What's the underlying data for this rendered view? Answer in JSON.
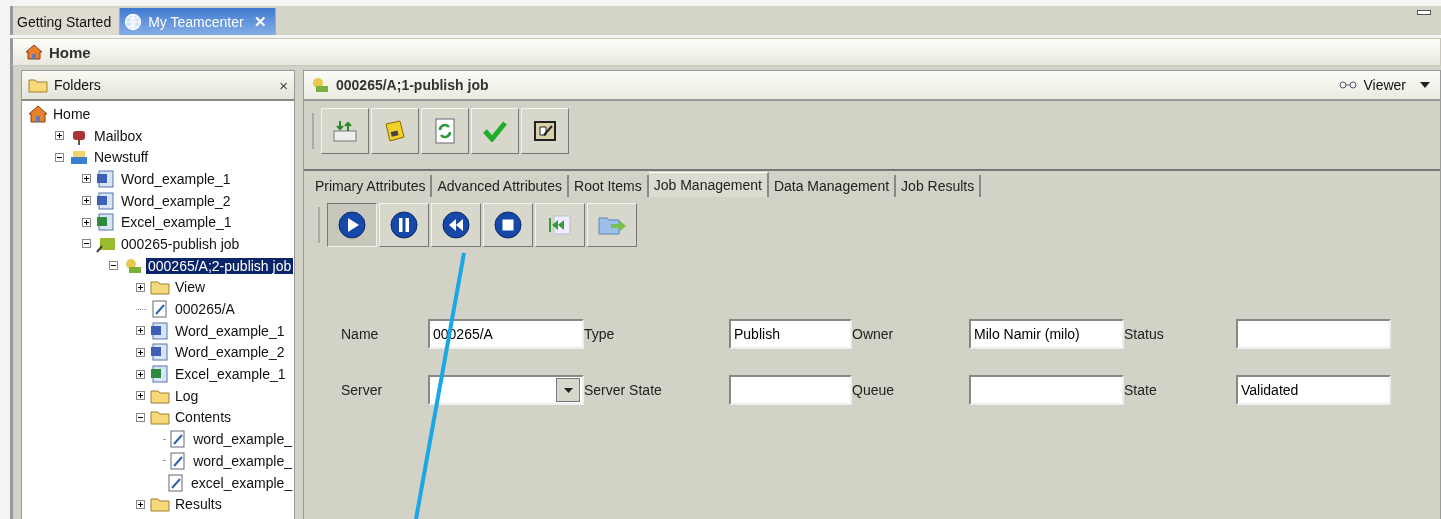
{
  "app_tabs": [
    {
      "label": "Getting Started",
      "selected": false
    },
    {
      "label": "My Teamcenter",
      "selected": true
    }
  ],
  "close_glyph": "✕",
  "breadcrumb": "Home",
  "folders_panel": {
    "title": "Folders",
    "close_glyph": "×",
    "tree": [
      {
        "label": "Home",
        "kind": "house",
        "selected": false,
        "children": [
          {
            "label": "Mailbox",
            "kind": "mailbox",
            "selected": false,
            "expanded": false
          },
          {
            "label": "Newstuff",
            "kind": "inbox",
            "selected": false,
            "expanded": true,
            "children": [
              {
                "label": "Word_example_1",
                "kind": "word",
                "selected": false,
                "expanded": false
              },
              {
                "label": "Word_example_2",
                "kind": "word",
                "selected": false,
                "expanded": false
              },
              {
                "label": "Excel_example_1",
                "kind": "excel",
                "selected": false,
                "expanded": false
              },
              {
                "label": "000265-publish job",
                "kind": "job",
                "selected": false,
                "expanded": true,
                "children": [
                  {
                    "label": "000265/A;2-publish job",
                    "kind": "revision",
                    "selected": true,
                    "expanded": true,
                    "children": [
                      {
                        "label": "View",
                        "kind": "folder",
                        "selected": false,
                        "expanded": false
                      },
                      {
                        "label": "000265/A",
                        "kind": "doc",
                        "selected": false
                      },
                      {
                        "label": "Word_example_1",
                        "kind": "word",
                        "selected": false,
                        "expanded": false
                      },
                      {
                        "label": "Word_example_2",
                        "kind": "word",
                        "selected": false,
                        "expanded": false
                      },
                      {
                        "label": "Excel_example_1",
                        "kind": "excel",
                        "selected": false,
                        "expanded": false
                      },
                      {
                        "label": "Log",
                        "kind": "folder",
                        "selected": false,
                        "expanded": false
                      },
                      {
                        "label": "Contents",
                        "kind": "folder",
                        "selected": false,
                        "expanded": true,
                        "children": [
                          {
                            "label": "word_example_",
                            "kind": "doc",
                            "selected": false
                          },
                          {
                            "label": "word_example_",
                            "kind": "doc",
                            "selected": false
                          },
                          {
                            "label": "excel_example_",
                            "kind": "doc",
                            "selected": false
                          }
                        ]
                      },
                      {
                        "label": "Results",
                        "kind": "folder",
                        "selected": false,
                        "expanded": false
                      }
                    ]
                  }
                ]
              }
            ]
          }
        ]
      }
    ]
  },
  "viewer": {
    "title": "000265/A;1-publish job",
    "mode": "Viewer"
  },
  "tabs": [
    {
      "label": "Primary Attributes",
      "selected": false
    },
    {
      "label": "Advanced Attributes",
      "selected": false
    },
    {
      "label": "Root Items",
      "selected": false
    },
    {
      "label": "Job Management",
      "selected": true
    },
    {
      "label": "Data Management",
      "selected": false
    },
    {
      "label": "Job Results",
      "selected": false
    }
  ],
  "fields": [
    {
      "label": "Name",
      "value": "000265/A",
      "kind": "text"
    },
    {
      "label": "Type",
      "value": "Publish",
      "kind": "text"
    },
    {
      "label": "Owner",
      "value": "Milo Namir (milo)",
      "kind": "text"
    },
    {
      "label": "Status",
      "kind": "text"
    },
    {
      "label": "Server",
      "kind": "dropdown"
    },
    {
      "label": "Server State",
      "kind": "text"
    },
    {
      "label": "Queue",
      "kind": "text"
    },
    {
      "label": "State",
      "value": "Validated",
      "kind": "text"
    }
  ]
}
